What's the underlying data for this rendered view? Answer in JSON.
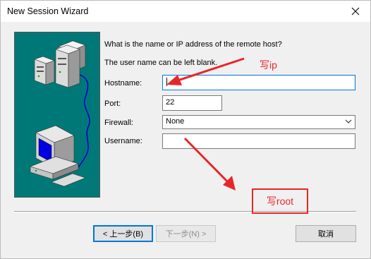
{
  "window": {
    "title": "New Session Wizard"
  },
  "prompt": {
    "question": "What is the name or IP address of the remote host?",
    "note": "The user name can be left blank."
  },
  "fields": {
    "hostname": {
      "label": "Hostname:",
      "value": ""
    },
    "port": {
      "label": "Port:",
      "value": "22"
    },
    "firewall": {
      "label": "Firewall:",
      "value": "None"
    },
    "username": {
      "label": "Username:",
      "value": ""
    }
  },
  "buttons": {
    "back": "< 上一步(B)",
    "next": "下一步(N) >",
    "cancel": "取消"
  },
  "annotations": {
    "hostname_note": "写ip",
    "username_note": "写root"
  },
  "colors": {
    "illustration_bg": "#007878",
    "annotation": "#e8262a",
    "focus": "#0078d7"
  },
  "icons": [
    "close-icon",
    "server-icon",
    "computer-icon",
    "dropdown-arrow-icon"
  ]
}
